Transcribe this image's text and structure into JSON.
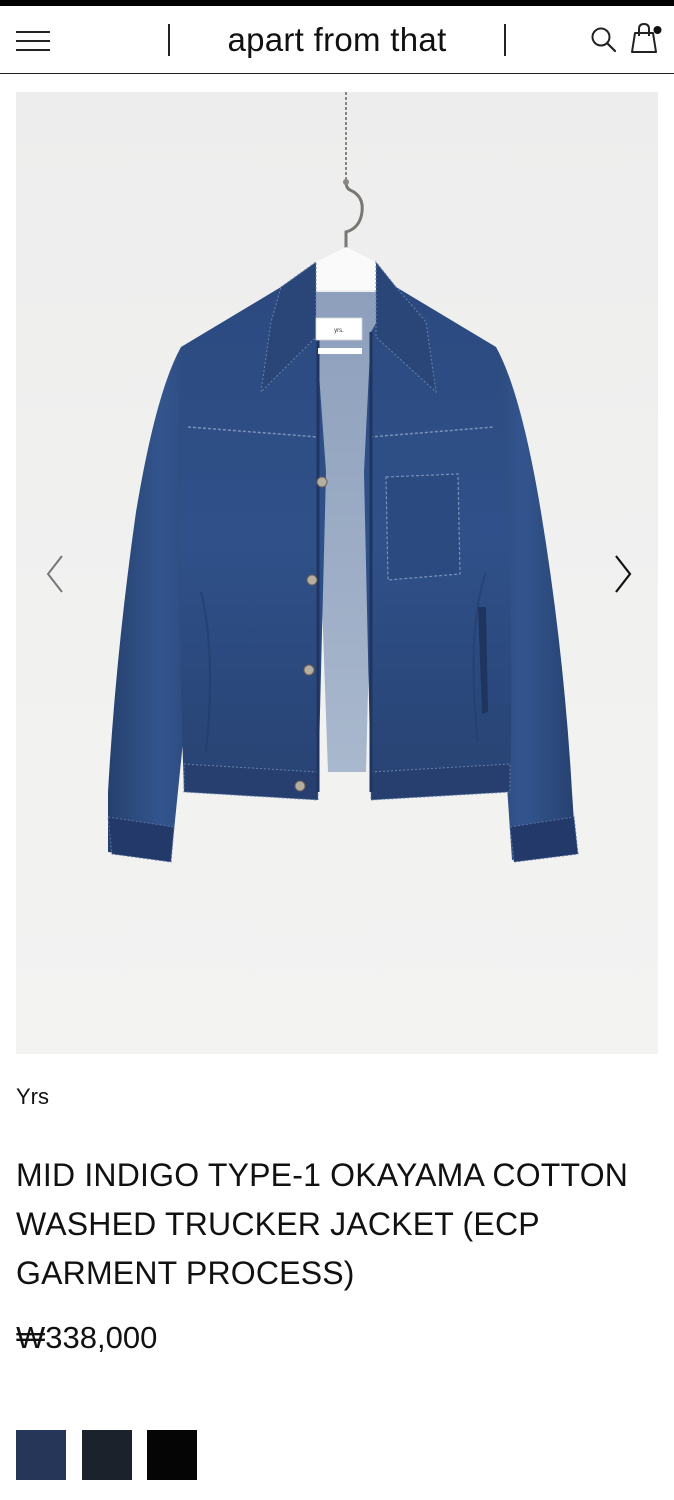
{
  "header": {
    "logo_text": "apart from that",
    "menu_icon": "hamburger-menu-icon",
    "search_icon": "search-icon",
    "cart_icon": "shopping-bag-icon"
  },
  "gallery": {
    "image_alt": "Mid indigo denim trucker jacket on hanger",
    "prev_icon": "chevron-left-icon",
    "next_icon": "chevron-right-icon"
  },
  "product": {
    "brand": "Yrs",
    "title": "MID INDIGO TYPE-1 OKAYAMA COTTON WASHED TRUCKER JACKET (ECP GARMENT PROCESS)",
    "price": "₩338,000",
    "label_brand": "yrs.",
    "swatches": [
      {
        "color": "#253659"
      },
      {
        "color": "#1c222c"
      },
      {
        "color": "#050505"
      }
    ]
  },
  "colors": {
    "denim": "#2f4f86",
    "denim_dark": "#213b6b",
    "background": "#efefee"
  }
}
